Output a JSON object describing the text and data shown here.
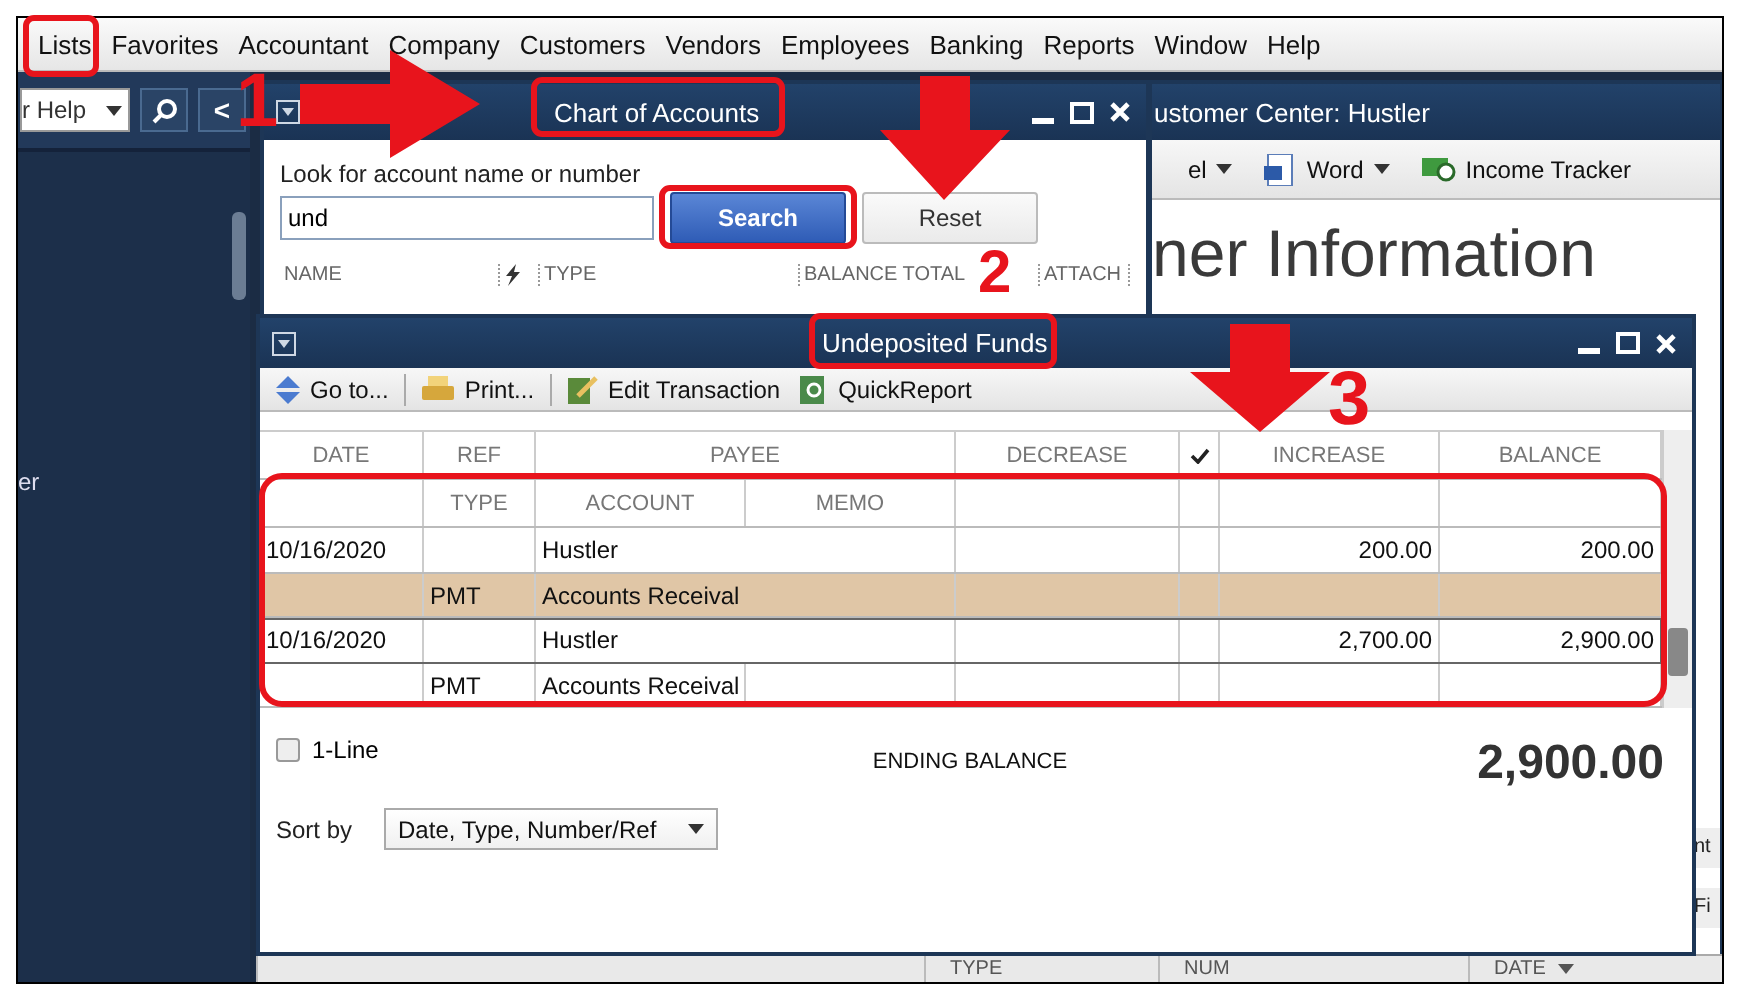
{
  "menu": [
    "Lists",
    "Favorites",
    "Accountant",
    "Company",
    "Customers",
    "Vendors",
    "Employees",
    "Banking",
    "Reports",
    "Window",
    "Help"
  ],
  "left_panel": {
    "help_search": "r Help",
    "back": "<",
    "side_text": "er"
  },
  "customer_center": {
    "title": "ustomer Center: Hustler",
    "toolbar": [
      {
        "label": "el",
        "kind": "dropdown"
      },
      {
        "label": "Word",
        "kind": "word"
      },
      {
        "label": "Income Tracker",
        "kind": "tracker"
      }
    ],
    "heading": "ner Information",
    "edge_texts": [
      "nt",
      "Fi"
    ]
  },
  "back_list": {
    "columns": [
      "TYPE",
      "NUM",
      "DATE"
    ]
  },
  "chart_of_accounts": {
    "title": "Chart of Accounts",
    "search_label": "Look for account name or number",
    "search_value": "und",
    "buttons": [
      "Search",
      "Reset"
    ],
    "columns": [
      "NAME",
      "TYPE",
      "BALANCE TOTAL",
      "ATTACH"
    ]
  },
  "register": {
    "title": "Undeposited Funds",
    "toolbar": [
      "Go to...",
      "Print...",
      "Edit Transaction",
      "QuickReport"
    ],
    "columns_top": [
      "DATE",
      "REF",
      "PAYEE",
      "DECREASE",
      "INCREASE",
      "BALANCE"
    ],
    "columns_bottom": [
      "TYPE",
      "ACCOUNT",
      "MEMO"
    ],
    "transactions": [
      {
        "date": "10/16/2020",
        "payee": "Hustler",
        "increase": "200.00",
        "balance": "200.00",
        "type": "PMT",
        "account": "Accounts Receival",
        "selected": true
      },
      {
        "date": "10/16/2020",
        "payee": "Hustler",
        "increase": "2,700.00",
        "balance": "2,900.00",
        "type": "PMT",
        "account": "Accounts Receival",
        "selected": false
      }
    ],
    "one_line": {
      "label": "1-Line",
      "checked": false
    },
    "ending_balance_label": "ENDING BALANCE",
    "ending_balance": "2,900.00",
    "sort_label": "Sort by",
    "sort_value": "Date, Type, Number/Ref"
  },
  "annotations": [
    "1",
    "2",
    "3"
  ]
}
